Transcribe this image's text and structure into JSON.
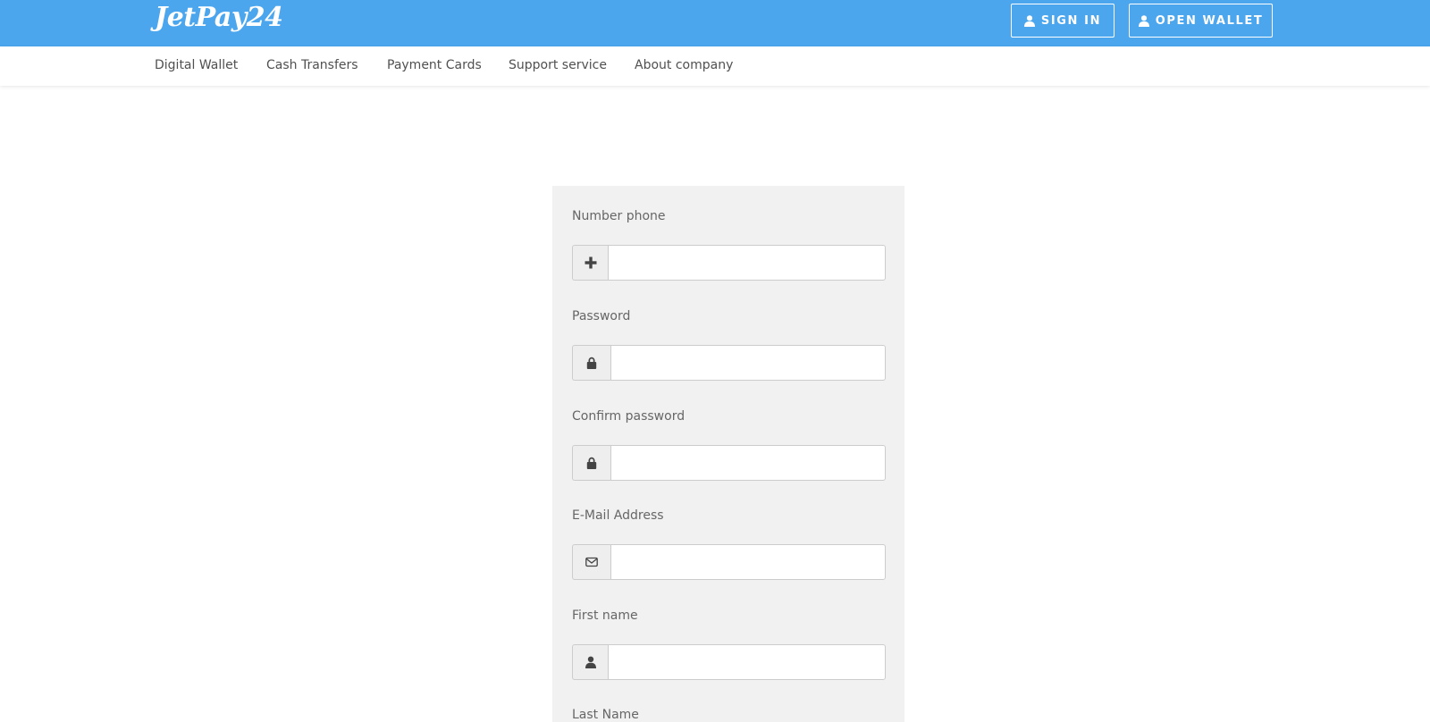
{
  "brand": {
    "logo_text": "JetPay24",
    "primary_color": "#4ba6ee"
  },
  "header": {
    "sign_in_label": "SIGN IN",
    "open_wallet_label": "OPEN WALLET",
    "button_icon": "user-icon"
  },
  "nav": {
    "items": [
      {
        "label": "Digital Wallet"
      },
      {
        "label": "Cash Transfers"
      },
      {
        "label": "Payment Cards"
      },
      {
        "label": "Support service"
      },
      {
        "label": "About company"
      }
    ]
  },
  "form": {
    "fields": [
      {
        "label": "Number phone",
        "icon": "plus-icon",
        "value": "",
        "placeholder": ""
      },
      {
        "label": "Password",
        "icon": "lock-icon",
        "value": "",
        "placeholder": ""
      },
      {
        "label": "Confirm password",
        "icon": "lock-icon",
        "value": "",
        "placeholder": ""
      },
      {
        "label": "E-Mail Address",
        "icon": "envelope-icon",
        "value": "",
        "placeholder": ""
      },
      {
        "label": "First name",
        "icon": "user-icon",
        "value": "",
        "placeholder": ""
      },
      {
        "label": "Last Name"
      }
    ]
  }
}
